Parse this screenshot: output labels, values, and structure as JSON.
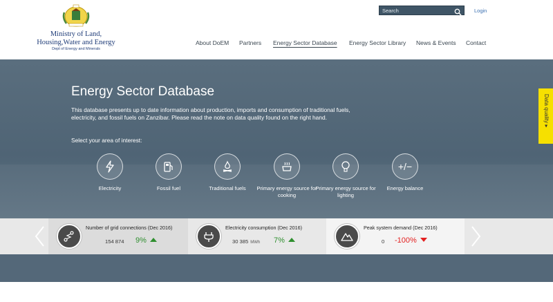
{
  "header": {
    "ministry_name": "Ministry of Land, Housing,Water and Energy",
    "department": "Dept of Energy and Minerals",
    "search": {
      "placeholder": "Search"
    },
    "login": "Login",
    "nav": [
      {
        "label": "About DoEM"
      },
      {
        "label": "Partners"
      },
      {
        "label": "Energy Sector Database",
        "active": true
      },
      {
        "label": "Energy Sector Library"
      },
      {
        "label": "News & Events"
      },
      {
        "label": "Contact"
      }
    ]
  },
  "hero": {
    "title": "Energy Sector Database",
    "description": "This database presents up to date information about production, imports and consumption of traditional fuels, electricity, and fossil fuels on Zanzibar. Please read the note on data quality found on the right hand.",
    "select_prompt": "Select your area of interest:",
    "areas": [
      {
        "icon": "lightning-icon",
        "label": "Electricity"
      },
      {
        "icon": "fuel-pump-icon",
        "label": "Fossil fuel"
      },
      {
        "icon": "campfire-icon",
        "label": "Traditional fuels"
      },
      {
        "icon": "cooking-pot-icon",
        "label": "Primary energy source for cooking"
      },
      {
        "icon": "light-bulb-icon",
        "label": "Primary energy source for lighting"
      },
      {
        "icon": "plus-minus-icon",
        "label": "Energy balance",
        "glyph": "+/−"
      }
    ]
  },
  "data_quality_tab": "Data quality ▸",
  "kpis": [
    {
      "icon": "grid-connection-icon",
      "title": "Number of grid connections (Dec 2016)",
      "value": "154 874",
      "unit": "",
      "change": "9%",
      "trend": "up"
    },
    {
      "icon": "plug-icon",
      "title": "Electricity consumption (Dec 2016)",
      "value": "30 385",
      "unit": "MWh",
      "change": "7%",
      "trend": "up"
    },
    {
      "icon": "mountain-peak-icon",
      "title": "Peak system demand (Dec 2016)",
      "value": "0",
      "unit": "",
      "change": "-100%",
      "trend": "down"
    }
  ],
  "colors": {
    "hero_bg": "#546879",
    "data_quality_tab": "#f6e000",
    "trend_up": "#2f8f2f",
    "trend_down": "#e32020",
    "search_bg": "#3f5566"
  }
}
